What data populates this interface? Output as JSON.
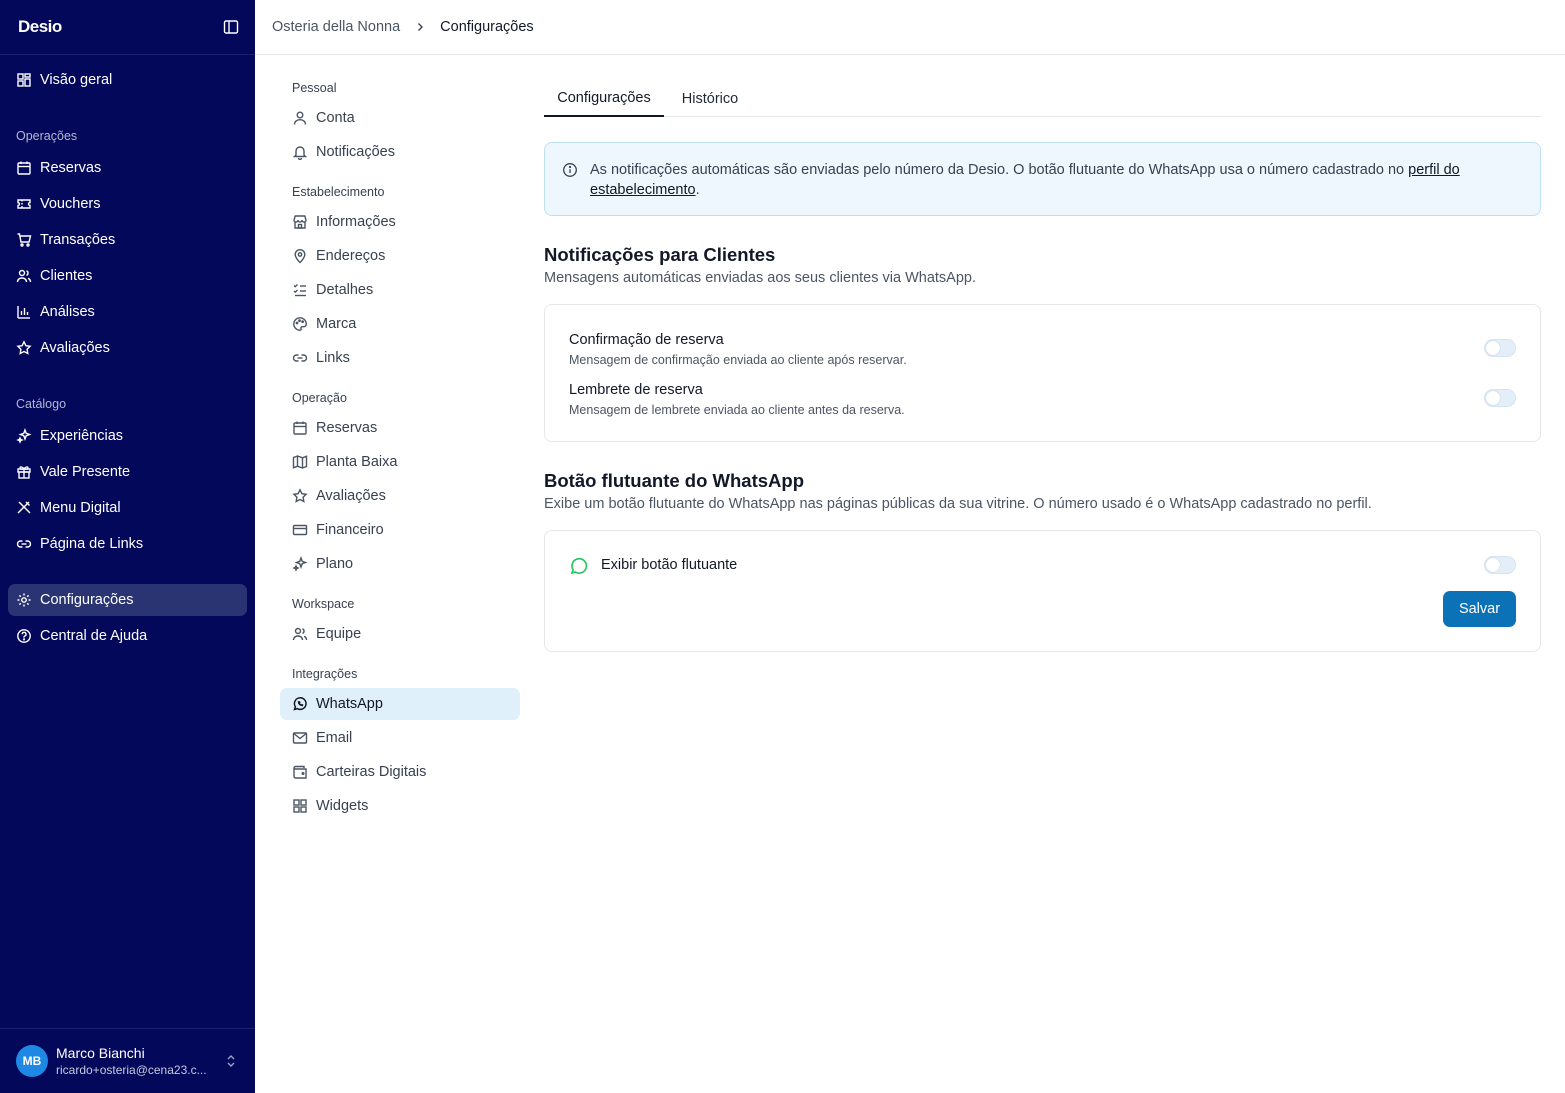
{
  "app": {
    "logo": "Desio"
  },
  "sidebar": {
    "overview": "Visão geral",
    "sections": {
      "operations": "Operações",
      "catalog": "Catálogo"
    },
    "operations_items": [
      "Reservas",
      "Vouchers",
      "Transações",
      "Clientes",
      "Análises",
      "Avaliações"
    ],
    "catalog_items": [
      "Experiências",
      "Vale Presente",
      "Menu Digital",
      "Página de Links"
    ],
    "settings": "Configurações",
    "help": "Central de Ajuda",
    "user": {
      "initials": "MB",
      "name": "Marco Bianchi",
      "email": "ricardo+osteria@cena23.c..."
    }
  },
  "breadcrumb": {
    "root": "Osteria della Nonna",
    "current": "Configurações"
  },
  "settings_nav": {
    "sections": {
      "personal": "Pessoal",
      "establishment": "Estabelecimento",
      "operation": "Operação",
      "workspace": "Workspace",
      "integrations": "Integrações"
    },
    "personal_items": [
      "Conta",
      "Notificações"
    ],
    "establishment_items": [
      "Informações",
      "Endereços",
      "Detalhes",
      "Marca",
      "Links"
    ],
    "operation_items": [
      "Reservas",
      "Planta Baixa",
      "Avaliações",
      "Financeiro",
      "Plano"
    ],
    "workspace_items": [
      "Equipe"
    ],
    "integration_items": [
      "WhatsApp",
      "Email",
      "Carteiras Digitais",
      "Widgets"
    ],
    "active_item": "WhatsApp"
  },
  "main": {
    "tabs": [
      "Configurações",
      "Histórico"
    ],
    "active_tab": "Configurações",
    "info": {
      "text": "As notificações automáticas são enviadas pelo número da Desio. O botão flutuante do WhatsApp usa o número cadastrado no ",
      "link": "perfil do estabelecimento",
      "suffix": "."
    },
    "client_notifications": {
      "title": "Notificações para Clientes",
      "description": "Mensagens automáticas enviadas aos seus clientes via WhatsApp.",
      "items": [
        {
          "title": "Confirmação de reserva",
          "description": "Mensagem de confirmação enviada ao cliente após reservar.",
          "enabled": false
        },
        {
          "title": "Lembrete de reserva",
          "description": "Mensagem de lembrete enviada ao cliente antes da reserva.",
          "enabled": false
        }
      ]
    },
    "floating_button": {
      "title": "Botão flutuante do WhatsApp",
      "description": "Exibe um botão flutuante do WhatsApp nas páginas públicas da sua vitrine. O número usado é o WhatsApp cadastrado no perfil.",
      "toggle_label": "Exibir botão flutuante",
      "enabled": false,
      "save_label": "Salvar"
    }
  },
  "colors": {
    "sidebar_bg": "#03085a",
    "sidebar_active": "#2a3473",
    "accent": "#0b72b8",
    "info_bg": "#eef7fd",
    "settings_active": "#e0f0fb",
    "whatsapp_green": "#22c55e"
  }
}
